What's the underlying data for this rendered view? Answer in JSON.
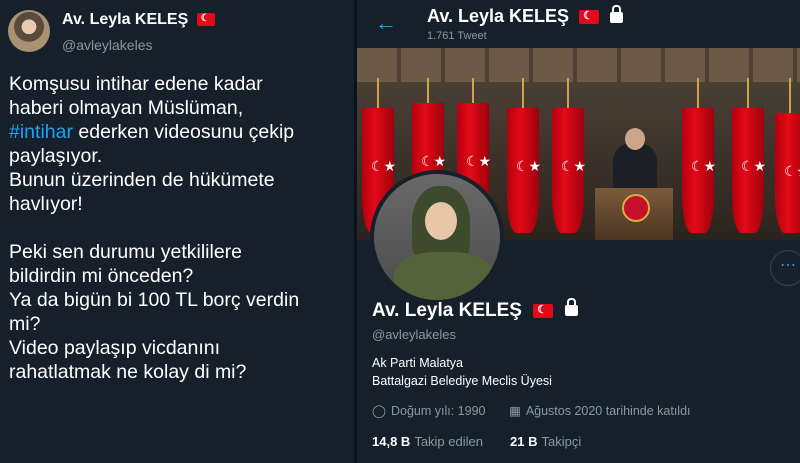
{
  "tweet": {
    "display_name": "Av. Leyla KELEŞ",
    "handle": "@avleylakeles",
    "text_before_hashtag": "Komşusu intihar edene kadar\nhaberi olmayan Müslüman,\n",
    "hashtag": "#intihar",
    "text_after_hashtag": " ederken videosunu çekip\npaylaşıyor.\nBunun üzerinden de hükümete\nhavlıyor!\n\nPeki sen durumu yetkililere\nbildirdin mi önceden?\nYa da bigün bi 100 TL borç verdin\nmi?\nVideo paylaşıp vicdanını\nrahatlatmak ne kolay di mi?"
  },
  "profile": {
    "header_name": "Av. Leyla KELEŞ",
    "tweet_count": "1.761 Tweet",
    "name": "Av. Leyla KELEŞ",
    "handle": "@avleylakeles",
    "bio_line1": "Ak Parti Malatya",
    "bio_line2": "Battalgazi Belediye Meclis Üyesi",
    "birth": "Doğum yılı: 1990",
    "joined": "Ağustos 2020 tarihinde katıldı",
    "following_count": "14,8 B",
    "following_label": "Takip edilen",
    "followers_count": "21 B",
    "followers_label": "Takipçi"
  },
  "icons": {
    "back": "back-arrow-icon",
    "more": "more-icon",
    "lock": "lock-icon",
    "flag": "turkey-flag-icon"
  },
  "colors": {
    "accent": "#1da1f2",
    "background": "#15202b",
    "muted": "#8899a6",
    "flag_red": "#e30a17"
  }
}
